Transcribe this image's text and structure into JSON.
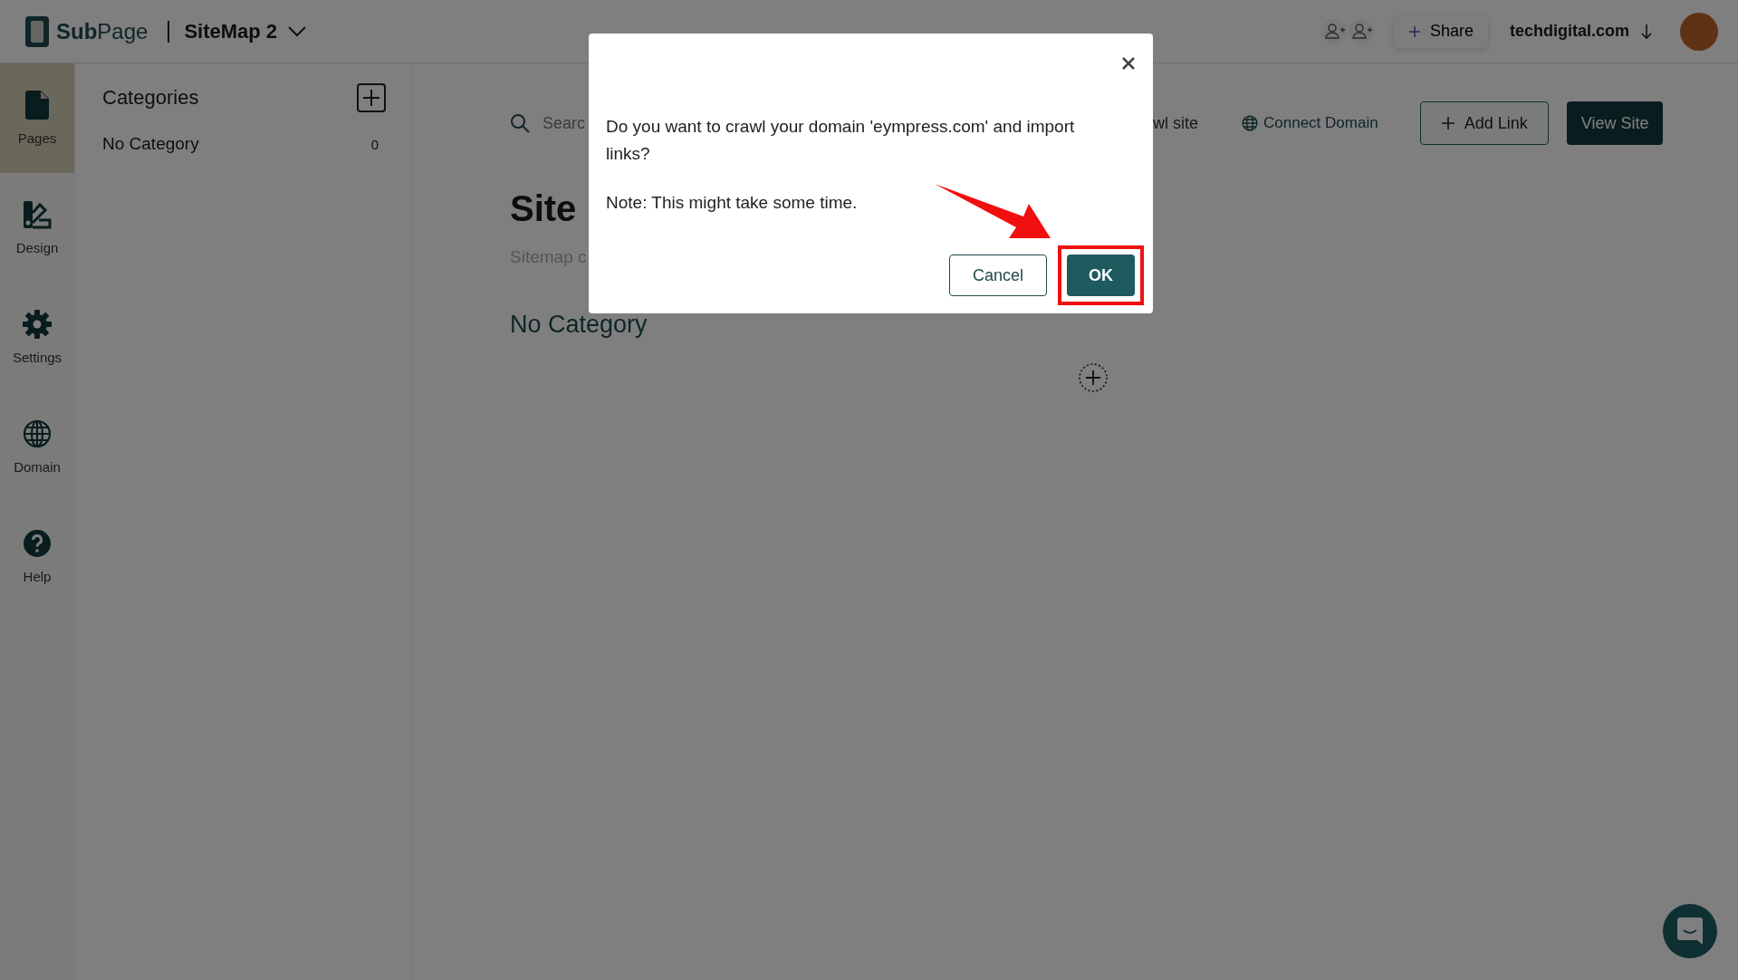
{
  "app": {
    "logo": "**Sub**Page",
    "project": "SiteMap 2",
    "share": "Share",
    "account": "techdigital.com"
  },
  "rail": [
    {
      "label": "Pages",
      "selected": true
    },
    {
      "label": "Design",
      "selected": false
    },
    {
      "label": "Settings",
      "selected": false
    },
    {
      "label": "Domain",
      "selected": false
    },
    {
      "label": "Help",
      "selected": false
    }
  ],
  "categories": {
    "title": "Categories",
    "items": [
      {
        "name": "No Category",
        "count": "0"
      }
    ]
  },
  "toolbar": {
    "search_placeholder": "Searc",
    "crawl": "wl site",
    "connect": "Connect Domain",
    "add_link": "Add Link",
    "view_site": "View Site"
  },
  "sitemap": {
    "title": "Site",
    "subtitle": "Sitemap c",
    "section": "No Category"
  },
  "dialog": {
    "message": "Do you want to crawl your domain 'eympress.com' and import links?",
    "note": "Note: This might take some time.",
    "buttons": [
      {
        "label": "Cancel",
        "kind": "secondary",
        "highlighted": false
      },
      {
        "label": "OK",
        "kind": "primary",
        "highlighted": true
      }
    ]
  }
}
